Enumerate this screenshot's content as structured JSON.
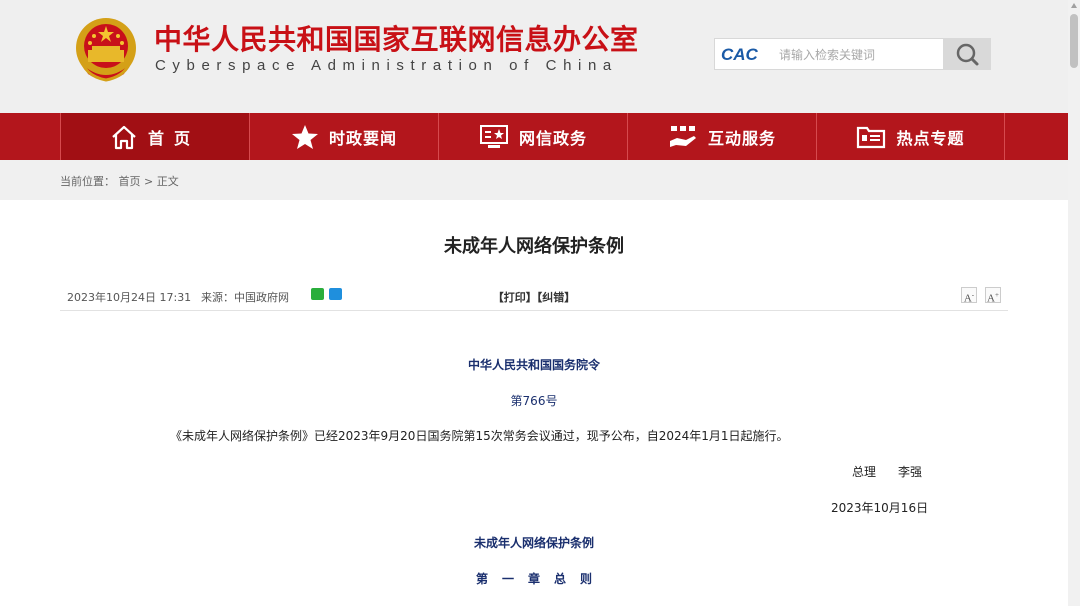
{
  "header": {
    "title": "中华人民共和国国家互联网信息办公室",
    "subtitle": "Cyberspace Administration of China",
    "search": {
      "logo": "CAC",
      "placeholder": "请输入检索关键词",
      "button_icon": "search-icon"
    }
  },
  "nav": {
    "items": [
      {
        "label": "首页",
        "icon": "home-icon"
      },
      {
        "label": "时政要闻",
        "icon": "star-icon"
      },
      {
        "label": "网信政务",
        "icon": "monitor-icon"
      },
      {
        "label": "互动服务",
        "icon": "hand-icon"
      },
      {
        "label": "热点专题",
        "icon": "folder-icon"
      }
    ]
  },
  "breadcrumb": {
    "prefix": "当前位置：",
    "home": "首页",
    "separator": ">",
    "current": "正文"
  },
  "article": {
    "title": "未成年人网络保护条例",
    "date": "2023年10月24日 17:31",
    "source_label": "来源：",
    "source": "中国政府网",
    "share_icons": [
      "wechat-icon",
      "qzone-icon"
    ],
    "print": "【打印】",
    "correct": "【纠错】",
    "font_decrease": "A",
    "font_increase": "A"
  },
  "body": {
    "decree_title": "中华人民共和国国务院令",
    "decree_no": "第766号",
    "paragraph": "《未成年人网络保护条例》已经2023年9月20日国务院第15次常务会议通过，现予公布，自2024年1月1日起施行。",
    "sign_role": "总理",
    "sign_name": "李强",
    "sign_date": "2023年10月16日",
    "regulation_title": "未成年人网络保护条例",
    "chapter_no": "第一章",
    "chapter_name": "总",
    "chapter_name2": "则"
  },
  "colors": {
    "brand_red": "#b3161c",
    "title_red": "#c81016",
    "decree_blue": "#1a2f6e"
  }
}
